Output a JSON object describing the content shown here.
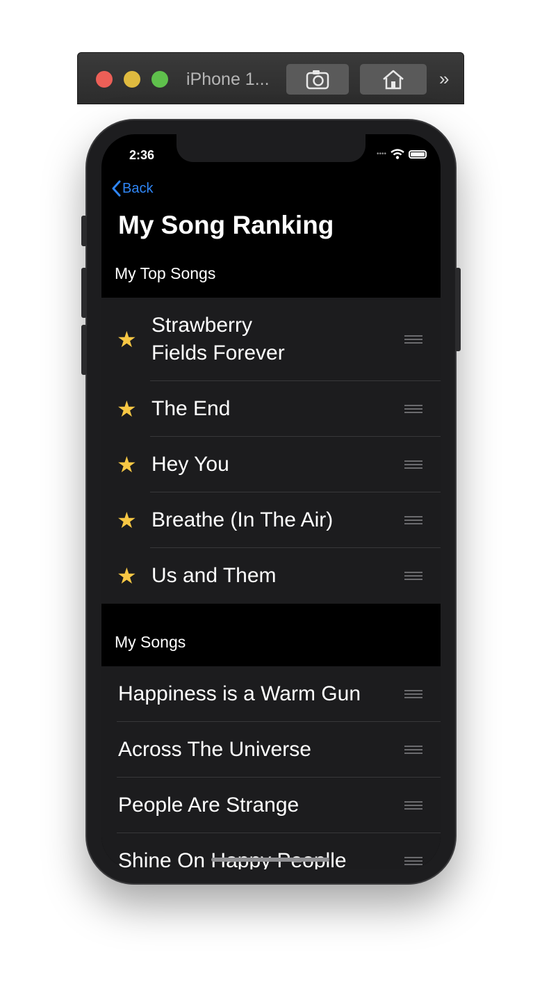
{
  "simulator": {
    "title": "iPhone 1...",
    "more_label": "»"
  },
  "status": {
    "time": "2:36",
    "signal": "••••"
  },
  "nav": {
    "back_label": "Back",
    "title": "My Song Ranking"
  },
  "sections": {
    "top": {
      "header": "My Top Songs",
      "items": [
        {
          "line1": "Strawberry",
          "line2": "Fields Forever"
        },
        {
          "title": "The End"
        },
        {
          "title": "Hey You"
        },
        {
          "title": "Breathe (In The Air)"
        },
        {
          "title": "Us and Them"
        }
      ]
    },
    "all": {
      "header": "My Songs",
      "items": [
        {
          "title": "Happiness is a Warm Gun"
        },
        {
          "title": "Across The Universe"
        },
        {
          "title": "People Are Strange"
        },
        {
          "title": "Shine On Happy Peoplle"
        }
      ]
    }
  },
  "colors": {
    "accent": "#2f86f6",
    "star": "#f7c744",
    "row_bg": "#1c1c1e",
    "separator": "#38383a"
  },
  "icons": {
    "star": "star-icon",
    "reorder": "reorder-handle-icon",
    "back": "chevron-left-icon"
  }
}
